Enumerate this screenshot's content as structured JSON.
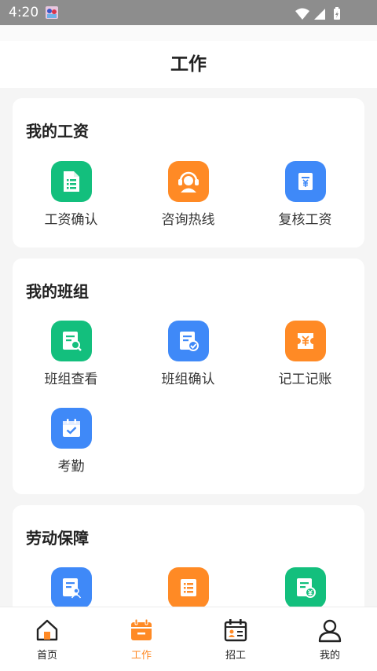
{
  "status_bar": {
    "time": "4:20"
  },
  "header": {
    "title": "工作"
  },
  "sections": [
    {
      "title": "我的工资",
      "items": [
        {
          "label": "工资确认",
          "icon": "document-list-icon",
          "color": "#13bf7d"
        },
        {
          "label": "咨询热线",
          "icon": "headset-agent-icon",
          "color": "#ff8a25"
        },
        {
          "label": "复核工资",
          "icon": "salary-document-icon",
          "color": "#3f89f8"
        }
      ]
    },
    {
      "title": "我的班组",
      "items": [
        {
          "label": "班组查看",
          "icon": "document-search-icon",
          "color": "#13bf7d"
        },
        {
          "label": "班组确认",
          "icon": "document-check-icon",
          "color": "#3f89f8"
        },
        {
          "label": "记工记账",
          "icon": "yuan-ticket-icon",
          "color": "#ff8a25"
        },
        {
          "label": "考勤",
          "icon": "calendar-check-icon",
          "color": "#3f89f8"
        }
      ]
    },
    {
      "title": "劳动保障",
      "items": [
        {
          "icon": "document-person-icon",
          "color": "#3f89f8"
        },
        {
          "icon": "list-icon",
          "color": "#ff8a25"
        },
        {
          "icon": "document-yuan-icon",
          "color": "#13bf7d"
        }
      ]
    }
  ],
  "tabbar": {
    "active_color": "#ff8a25",
    "tabs": [
      {
        "label": "首页",
        "icon": "home-icon"
      },
      {
        "label": "工作",
        "icon": "briefcase-calendar-icon",
        "active": true
      },
      {
        "label": "招工",
        "icon": "recruit-calendar-icon"
      },
      {
        "label": "我的",
        "icon": "person-icon"
      }
    ]
  }
}
